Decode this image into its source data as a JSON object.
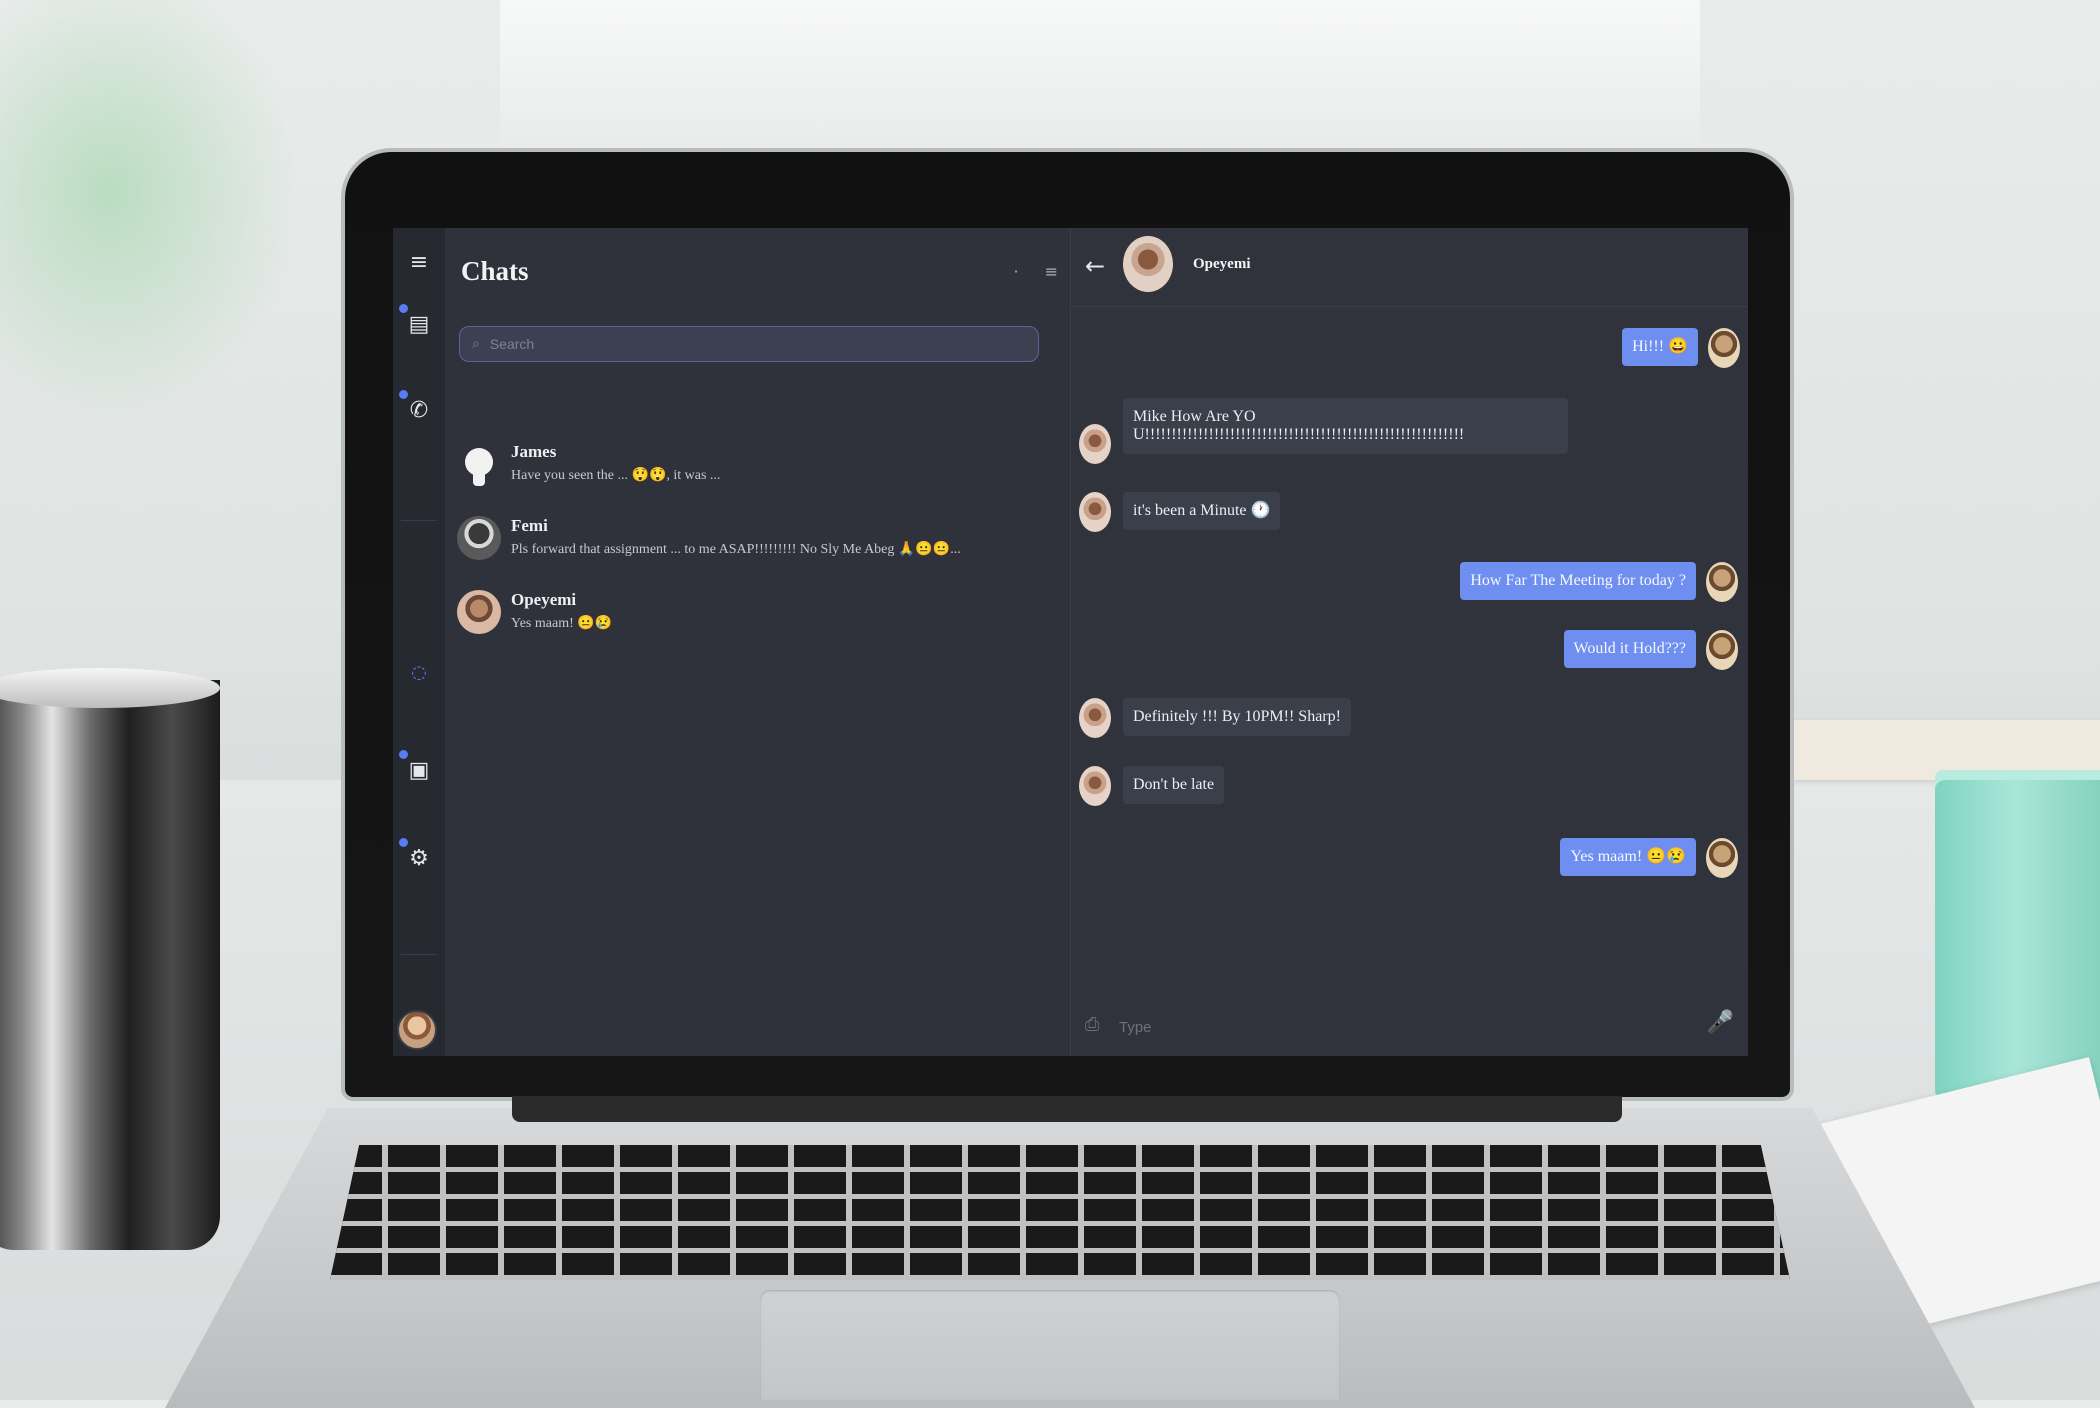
{
  "app": {
    "rail": {
      "menu_icon": "hamburger-icon",
      "items": [
        {
          "name": "chats",
          "icon": "chat-bubble-icon",
          "glyph": "▤"
        },
        {
          "name": "calls",
          "icon": "phone-icon",
          "glyph": "✆"
        },
        {
          "name": "status",
          "icon": "status-ring-icon",
          "glyph": "◌"
        },
        {
          "name": "saved",
          "icon": "bookmark-box-icon",
          "glyph": "▣"
        },
        {
          "name": "settings",
          "icon": "gear-icon",
          "glyph": "⚙"
        }
      ]
    },
    "chat_list": {
      "title": "Chats",
      "search_placeholder": "Search",
      "items": [
        {
          "name": "James",
          "preview": "Have you seen the ... 😲😲, it was ...",
          "avatar": "github-avatar"
        },
        {
          "name": "Femi",
          "preview": "Pls forward that assignment ... to me ASAP!!!!!!!!! No Sly Me Abeg 🙏😐😐...",
          "avatar": "femi-avatar"
        },
        {
          "name": "Opeyemi",
          "preview": "Yes maam! 😐😢",
          "avatar": "opeyemi-avatar"
        }
      ]
    },
    "conversation": {
      "contact_name": "Opeyemi",
      "messages": [
        {
          "dir": "out",
          "text": "Hi!!! 😀"
        },
        {
          "dir": "in",
          "text": "Mike How Are YOU!!!!!!!!!!!!!!!!!!!!!!!!!!!!!!!!!!!!!!!!!!!!!!!!!!!!!!!!!!!!"
        },
        {
          "dir": "in",
          "text": "it's been a Minute 🕐"
        },
        {
          "dir": "out",
          "text": "How Far The Meeting for today ?"
        },
        {
          "dir": "out",
          "text": "Would it Hold???"
        },
        {
          "dir": "in",
          "text": "Definitely !!! By 10PM!! Sharp!"
        },
        {
          "dir": "in",
          "text": "Don't be late"
        },
        {
          "dir": "out",
          "text": "Yes maam! 😐😢"
        }
      ],
      "input_placeholder": "Type",
      "mic_icon": "microphone-icon",
      "attach_icon": "attachment-icon"
    }
  },
  "colors": {
    "accent": "#6e8ef0",
    "rail_bg": "#262930",
    "panel_bg": "#2f323b",
    "incoming_bubble": "#3b3f4a"
  }
}
